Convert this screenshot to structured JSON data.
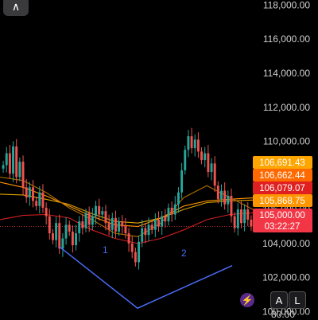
{
  "ui": {
    "back_label": "∧",
    "auto_label": "A",
    "log_label": "L",
    "bottom_tick": "80.00"
  },
  "colors": {
    "background": "#000000",
    "up_candle": "#26a69a",
    "down_candle": "#ef5350",
    "pattern_line": "#4a6cf7",
    "ma_red": "#d02020",
    "ma_orange": "#ff9500",
    "ma_yellow": "#e0a000"
  },
  "chart_data": {
    "type": "candlestick",
    "ylim": [
      99600,
      118300
    ],
    "y_ticks": [
      {
        "value": 100000,
        "label": "100,000.00"
      },
      {
        "value": 102000,
        "label": "102,000.00"
      },
      {
        "value": 104000,
        "label": "104,000.00"
      },
      {
        "value": 106000,
        "label": "106,000.00"
      },
      {
        "value": 108000,
        "label": "108,000.00"
      },
      {
        "value": 110000,
        "label": "110,000.00"
      },
      {
        "value": 112000,
        "label": "112,000.00"
      },
      {
        "value": 114000,
        "label": "114,000.00"
      },
      {
        "value": 116000,
        "label": "116,000.00"
      },
      {
        "value": 118000,
        "label": "118,000.00"
      }
    ],
    "price_tags": [
      {
        "value": 106691.43,
        "label": "106,691.43",
        "color": "#ffa500"
      },
      {
        "value": 106662.44,
        "label": "106,662.44",
        "color": "#ff6a00"
      },
      {
        "value": 106079.07,
        "label": "106,079.07",
        "color": "#e02020"
      },
      {
        "value": 105868.75,
        "label": "105,868.75",
        "color": "#ff9500"
      },
      {
        "value": 105000.0,
        "label": "105,000.00",
        "sub": "03:22:27",
        "color": "#f23645"
      }
    ],
    "current_price": 105000.0,
    "candle_closes": [
      108600,
      109300,
      108100,
      109700,
      107900,
      108800,
      107300,
      106700,
      107300,
      106500,
      106200,
      107000,
      106100,
      105600,
      104600,
      104200,
      105200,
      103700,
      104300,
      105100,
      104700,
      103900,
      104600,
      105300,
      104900,
      105800,
      105100,
      105600,
      106200,
      105700,
      105900,
      105200,
      104800,
      105500,
      104700,
      105300,
      105000,
      104600,
      104000,
      103500,
      102900,
      104100,
      104900,
      104500,
      105100,
      104800,
      105400,
      105000,
      105600,
      105300,
      106100,
      105700,
      106300,
      107000,
      108300,
      109500,
      110300,
      109600,
      110100,
      109400,
      108900,
      109300,
      108200,
      108700,
      107400,
      106600,
      107100,
      106300,
      106800,
      105600,
      104900,
      106000,
      105200,
      106000,
      105400,
      105000
    ],
    "moving_averages": [
      {
        "color": "#d02020",
        "values": [
          105400,
          105650,
          105700,
          105500,
          104800,
          104300,
          104000,
          104300,
          104800,
          105400,
          105700,
          105800
        ]
      },
      {
        "color": "#e0a000",
        "values": [
          106900,
          106850,
          106600,
          106300,
          105750,
          105300,
          105200,
          105500,
          106000,
          106400,
          106500,
          106550
        ]
      },
      {
        "color": "#ff9500",
        "values": [
          107600,
          107300,
          106800,
          106200,
          105600,
          105100,
          105000,
          105500,
          106200,
          106500,
          106600,
          106680
        ]
      },
      {
        "color": "#b07000",
        "values": [
          107900,
          107700,
          107000,
          106100,
          105400,
          104600,
          104400,
          105200,
          106700,
          107400,
          106700,
          106000
        ]
      }
    ],
    "pattern": {
      "points": [
        {
          "label": "",
          "price": 103800
        },
        {
          "label": "",
          "price": 100200
        },
        {
          "label": "",
          "price": 102700
        }
      ],
      "labels": [
        "1",
        "2"
      ]
    }
  }
}
